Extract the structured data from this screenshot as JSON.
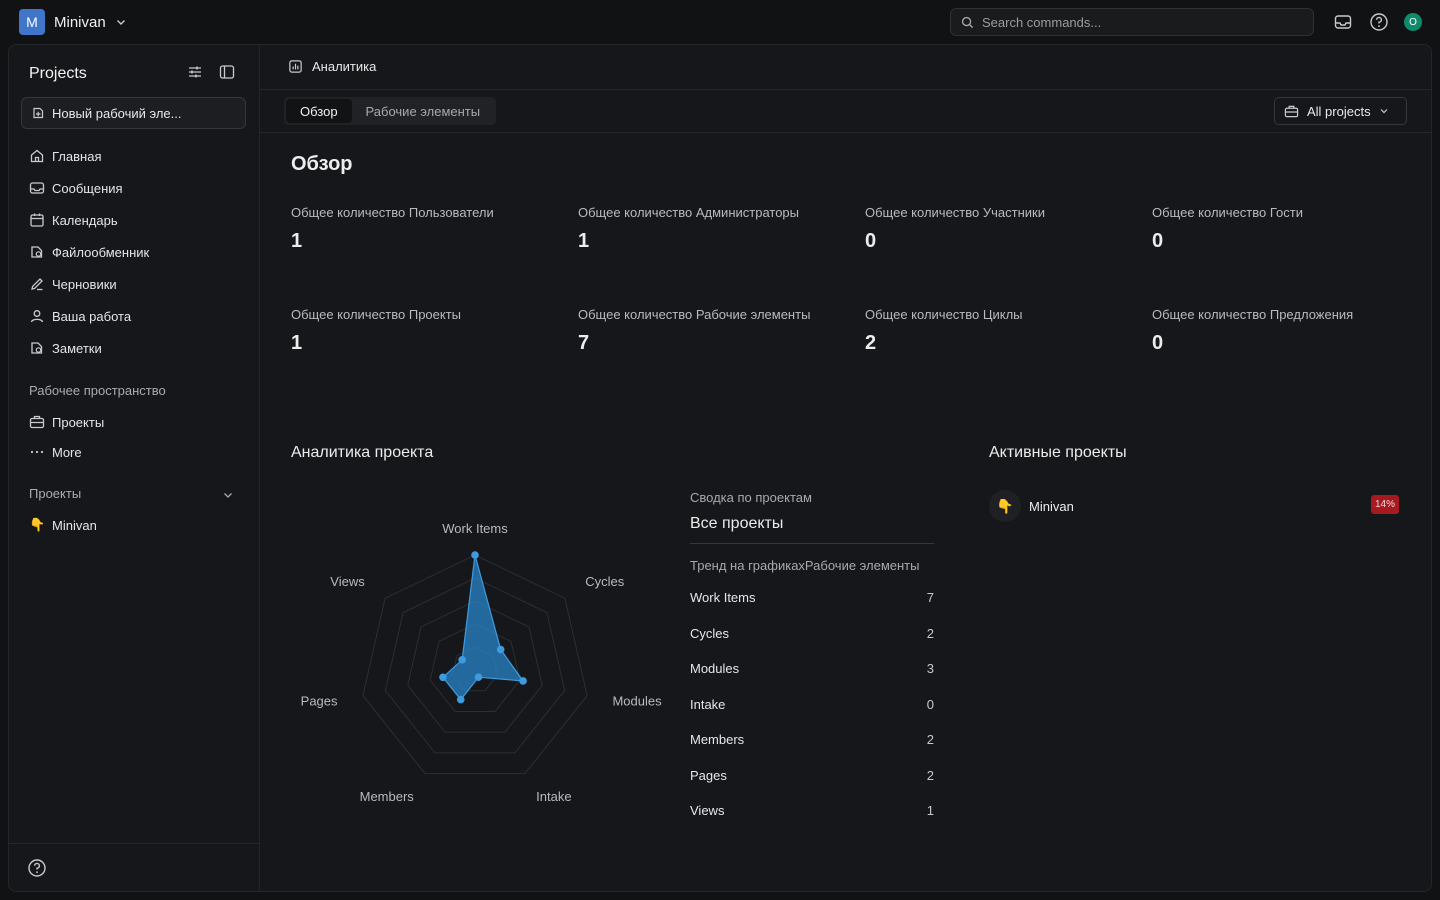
{
  "topbar": {
    "workspace_initial": "M",
    "workspace_name": "Minivan",
    "search_placeholder": "Search commands...",
    "user_initial": "O"
  },
  "sidebar": {
    "title": "Projects",
    "new_item": "Новый рабочий эле...",
    "nav": [
      {
        "label": "Главная",
        "icon": "home-icon"
      },
      {
        "label": "Сообщения",
        "icon": "inbox-icon"
      },
      {
        "label": "Календарь",
        "icon": "calendar-icon"
      },
      {
        "label": "Файлообменник",
        "icon": "file-share-icon"
      },
      {
        "label": "Черновики",
        "icon": "pencil-icon"
      },
      {
        "label": "Ваша работа",
        "icon": "user-icon"
      },
      {
        "label": "Заметки",
        "icon": "notes-icon"
      }
    ],
    "workspace_section": "Рабочее пространство",
    "workspace_items": [
      {
        "label": "Проекты",
        "icon": "briefcase-icon"
      },
      {
        "label": "More",
        "icon": "more-icon"
      }
    ],
    "projects_section": "Проекты",
    "projects": [
      {
        "label": "Minivan",
        "emoji": "👇"
      }
    ]
  },
  "main": {
    "breadcrumb": "Аналитика",
    "tabs": [
      {
        "label": "Обзор",
        "active": true
      },
      {
        "label": "Рабочие элементы",
        "active": false
      }
    ],
    "project_filter": "All projects",
    "overview_title": "Обзор",
    "stats": [
      {
        "label": "Общее количество Пользователи",
        "value": "1"
      },
      {
        "label": "Общее количество Администраторы",
        "value": "1"
      },
      {
        "label": "Общее количество Участники",
        "value": "0"
      },
      {
        "label": "Общее количество Гости",
        "value": "0"
      },
      {
        "label": "Общее количество Проекты",
        "value": "1"
      },
      {
        "label": "Общее количество Рабочие элементы",
        "value": "7"
      },
      {
        "label": "Общее количество Циклы",
        "value": "2"
      },
      {
        "label": "Общее количество Предложения",
        "value": "0"
      }
    ],
    "project_analytics_title": "Аналитика проекта",
    "summary": {
      "subtitle": "Сводка по проектам",
      "title": "Все проекты",
      "column": "Тренд на графикахРабочие элементы",
      "rows": [
        {
          "label": "Work Items",
          "value": "7"
        },
        {
          "label": "Cycles",
          "value": "2"
        },
        {
          "label": "Modules",
          "value": "3"
        },
        {
          "label": "Intake",
          "value": "0"
        },
        {
          "label": "Members",
          "value": "2"
        },
        {
          "label": "Pages",
          "value": "2"
        },
        {
          "label": "Views",
          "value": "1"
        }
      ]
    },
    "active_projects_title": "Активные проекты",
    "active_projects": [
      {
        "name": "Minivan",
        "emoji": "👇",
        "progress": "14%"
      }
    ]
  },
  "chart_data": {
    "type": "radar",
    "categories": [
      "Work Items",
      "Cycles",
      "Modules",
      "Intake",
      "Members",
      "Pages",
      "Views"
    ],
    "values": [
      7,
      2,
      3,
      0,
      2,
      2,
      1
    ],
    "rmax": 7,
    "colors": {
      "fill": "#2a86c9",
      "stroke": "#3d9be0",
      "grid": "#2c2e31"
    }
  }
}
